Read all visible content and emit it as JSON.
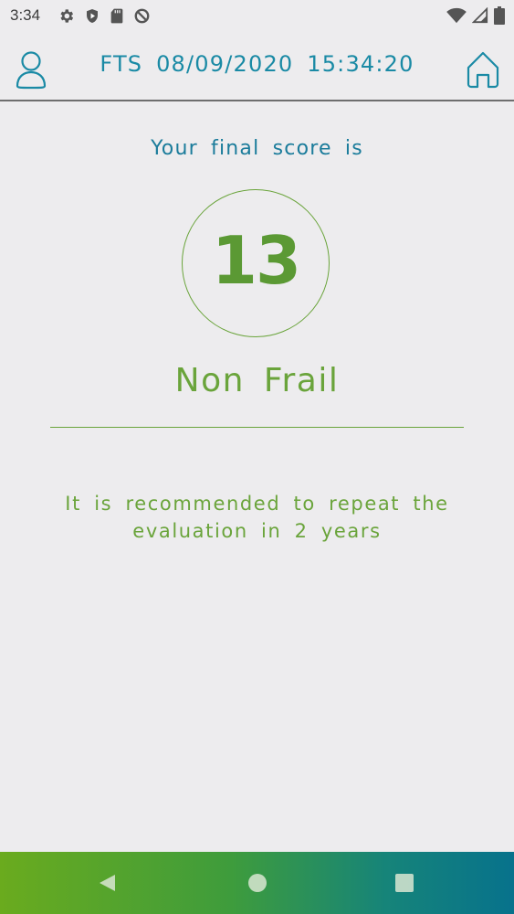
{
  "status_bar": {
    "time": "3:34",
    "left_icons": [
      "settings-icon",
      "shield-icon",
      "sd-card-icon",
      "data-saver-icon"
    ],
    "right_icons": [
      "wifi-icon",
      "cellular-signal-icon",
      "battery-icon"
    ]
  },
  "header": {
    "title": "FTS  08/09/2020  15:34:20",
    "left_icon": "user-profile-icon",
    "right_icon": "home-icon"
  },
  "result": {
    "label": "Your final score is",
    "score": "13",
    "classification": "Non Frail",
    "recommendation": "It is recommended to repeat the evaluation in 2 years"
  },
  "nav_bar": {
    "buttons": [
      "back-icon",
      "home-icon",
      "recents-icon"
    ]
  },
  "colors": {
    "header_text": "#1a8aa5",
    "score_green": "#5b9934",
    "accent_green": "#6aa43b",
    "background": "#edecee"
  }
}
